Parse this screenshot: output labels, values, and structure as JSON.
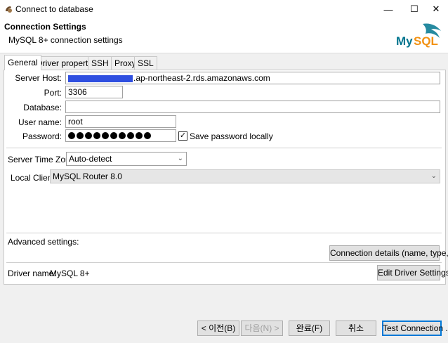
{
  "window": {
    "title": "Connect to database",
    "controls": [
      "—",
      "☐",
      "✕"
    ]
  },
  "header": {
    "title": "Connection Settings",
    "subtitle": "MySQL 8+ connection settings",
    "logo_text": "MySQL"
  },
  "tabs": [
    {
      "label": "General",
      "active": true
    },
    {
      "label": "Driver properties"
    },
    {
      "label": "SSH"
    },
    {
      "label": "Proxy"
    },
    {
      "label": "SSL"
    }
  ],
  "form": {
    "server_host_label": "Server Host:",
    "server_host_value": ".ap-northeast-2.rds.amazonaws.com",
    "port_label": "Port:",
    "port_value": "3306",
    "database_label": "Database:",
    "database_value": "",
    "username_label": "User name:",
    "username_value": "root",
    "password_label": "Password:",
    "password_mask_count": 10,
    "save_password_label": "Save password locally",
    "save_password_checked": "✓",
    "timezone_label": "Server Time Zone:",
    "timezone_value": "Auto-detect",
    "local_client_label": "Local Client:",
    "local_client_value": "MySQL Router 8.0",
    "advanced_label": "Advanced settings:",
    "connection_details_button": "Connection details (name, type, ... )",
    "driver_name_label": "Driver name:",
    "driver_name_value": "MySQL 8+",
    "edit_driver_button": "Edit Driver Settings"
  },
  "footer": {
    "back_button": "< 이전(B)",
    "next_button": "다음(N) >",
    "finish_button": "완료(F)",
    "cancel_button": "취소",
    "test_button": "Test Connection ..."
  },
  "colors": {
    "mysql_blue": "#00758f",
    "mysql_orange": "#f29111",
    "focus_border": "#0078d7"
  }
}
